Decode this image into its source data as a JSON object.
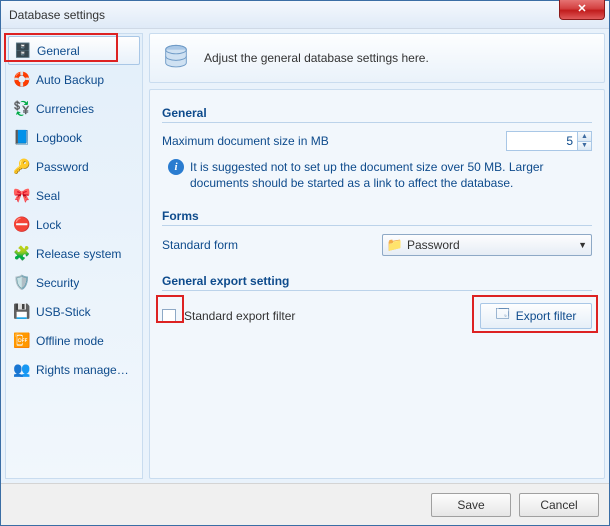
{
  "window": {
    "title": "Database settings"
  },
  "sidebar": {
    "items": [
      {
        "label": "General",
        "icon": "🗄️",
        "selected": true
      },
      {
        "label": "Auto Backup",
        "icon": "🛟",
        "selected": false
      },
      {
        "label": "Currencies",
        "icon": "💱",
        "selected": false
      },
      {
        "label": "Logbook",
        "icon": "📘",
        "selected": false
      },
      {
        "label": "Password",
        "icon": "🔑",
        "selected": false
      },
      {
        "label": "Seal",
        "icon": "🎀",
        "selected": false
      },
      {
        "label": "Lock",
        "icon": "⛔",
        "selected": false
      },
      {
        "label": "Release system",
        "icon": "🧩",
        "selected": false
      },
      {
        "label": "Security",
        "icon": "🛡️",
        "selected": false
      },
      {
        "label": "USB-Stick",
        "icon": "💾",
        "selected": false
      },
      {
        "label": "Offline mode",
        "icon": "📴",
        "selected": false
      },
      {
        "label": "Rights management",
        "icon": "👥",
        "selected": false
      }
    ]
  },
  "banner": {
    "text": "Adjust the general database settings here."
  },
  "sections": {
    "general": {
      "title": "General",
      "maxDocLabel": "Maximum document size in MB",
      "maxDocValue": "5",
      "hint": "It is suggested not to set up the document size over 50 MB. Larger documents should be started as a link to affect the database."
    },
    "forms": {
      "title": "Forms",
      "standardFormLabel": "Standard form",
      "standardFormValue": "Password"
    },
    "export": {
      "title": "General export setting",
      "stdFilterLabel": "Standard export filter",
      "stdFilterChecked": false,
      "exportFilterBtn": "Export filter"
    }
  },
  "footer": {
    "save": "Save",
    "cancel": "Cancel"
  }
}
